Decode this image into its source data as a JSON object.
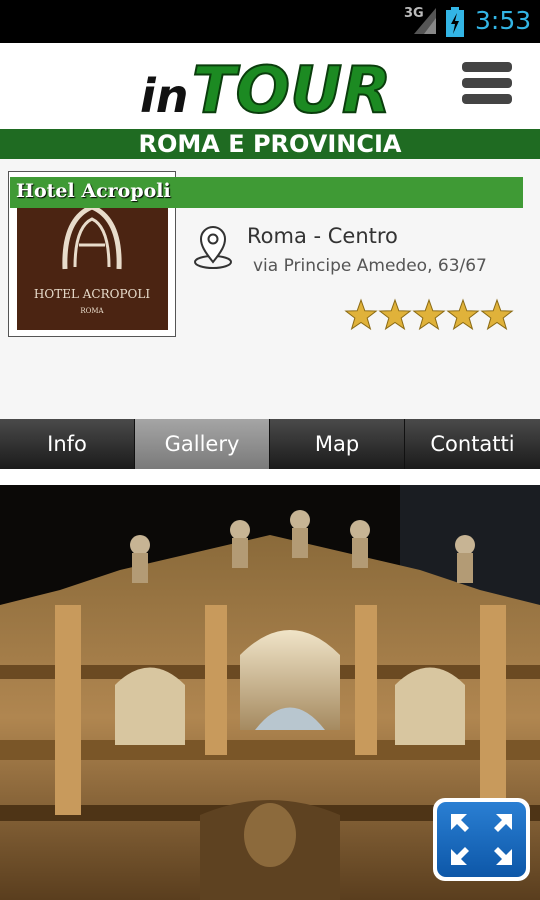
{
  "status_bar": {
    "network": "3G",
    "time": "3:53"
  },
  "header": {
    "logo_prefix": "in",
    "logo_main": "TOUR",
    "region": "ROMA E PROVINCIA"
  },
  "hotel": {
    "name": "Hotel Acropoli",
    "logo_text": "HOTEL ACROPOLI",
    "logo_subtext": "ROMA",
    "city": "Roma - Centro",
    "address": "via Principe Amedeo, 63/67",
    "rating": 5
  },
  "tabs": [
    {
      "label": "Info",
      "active": false
    },
    {
      "label": "Gallery",
      "active": true
    },
    {
      "label": "Map",
      "active": false
    },
    {
      "label": "Contatti",
      "active": false
    }
  ],
  "colors": {
    "brand_green": "#1f6b22",
    "name_bar": "#3f9a35",
    "star": "#e0b23a",
    "time": "#33b5e5"
  },
  "icons": [
    "menu-icon",
    "location-pin-icon",
    "expand-icon",
    "signal-icon",
    "battery-icon"
  ]
}
